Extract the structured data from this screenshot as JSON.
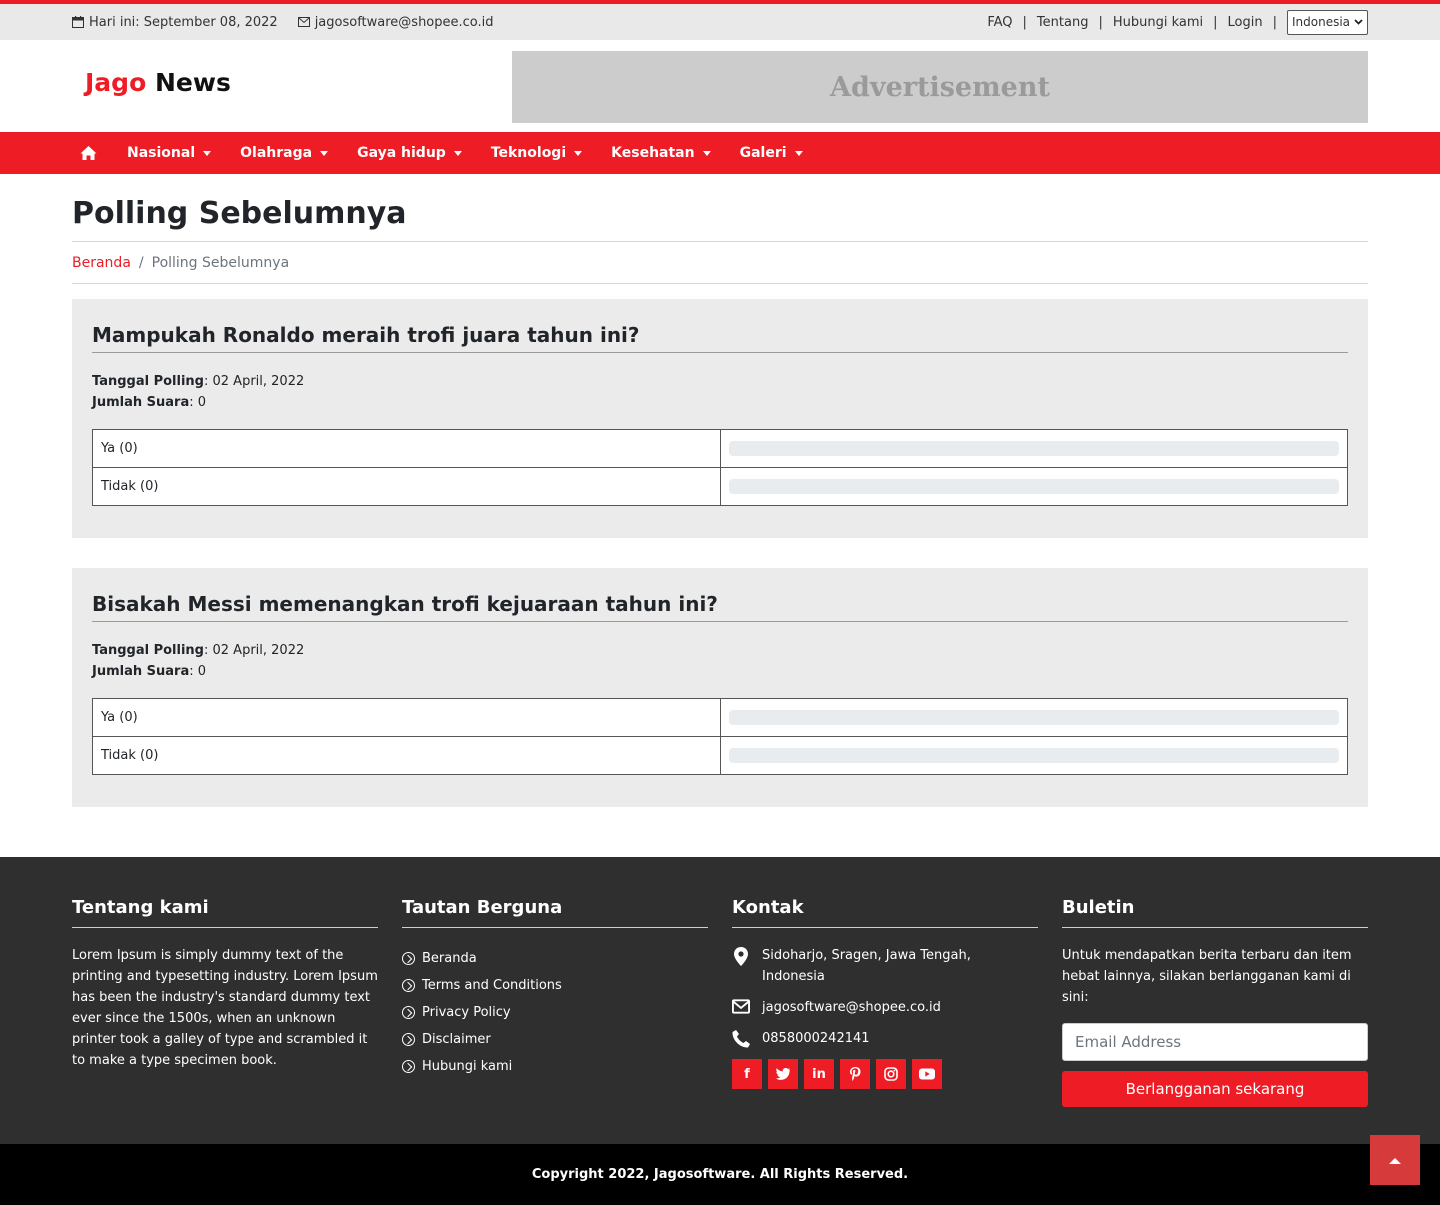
{
  "topbar": {
    "date": "Hari ini: September 08, 2022",
    "email": "jagosoftware@shopee.co.id",
    "links": [
      "FAQ",
      "Tentang",
      "Hubungi kami",
      "Login"
    ],
    "language": "Indonesia"
  },
  "header": {
    "logo_part1": "Jago",
    "logo_part2": "News",
    "ad_text": "Advertisement"
  },
  "nav": {
    "items": [
      "Nasional",
      "Olahraga",
      "Gaya hidup",
      "Teknologi",
      "Kesehatan",
      "Galeri"
    ]
  },
  "page": {
    "title": "Polling Sebelumnya",
    "breadcrumb_home": "Beranda",
    "breadcrumb_sep": "/",
    "breadcrumb_current": "Polling Sebelumnya"
  },
  "polls": [
    {
      "question": "Mampukah Ronaldo meraih trofi juara tahun ini?",
      "date_label": "Tanggal Polling",
      "date": ": 02 April, 2022",
      "votes_label": "Jumlah Suara",
      "votes": ": 0",
      "options": [
        {
          "label": "Ya (0)",
          "percent": 0
        },
        {
          "label": "Tidak (0)",
          "percent": 0
        }
      ]
    },
    {
      "question": "Bisakah Messi memenangkan trofi kejuaraan tahun ini?",
      "date_label": "Tanggal Polling",
      "date": ": 02 April, 2022",
      "votes_label": "Jumlah Suara",
      "votes": ": 0",
      "options": [
        {
          "label": "Ya (0)",
          "percent": 0
        },
        {
          "label": "Tidak (0)",
          "percent": 0
        }
      ]
    }
  ],
  "footer": {
    "about_title": "Tentang kami",
    "about_text": "Lorem Ipsum is simply dummy text of the printing and typesetting industry. Lorem Ipsum has been the industry's standard dummy text ever since the 1500s, when an unknown printer took a galley of type and scrambled it to make a type specimen book.",
    "links_title": "Tautan Berguna",
    "links": [
      "Beranda",
      "Terms and Conditions",
      "Privacy Policy",
      "Disclaimer",
      "Hubungi kami"
    ],
    "contact_title": "Kontak",
    "address": "Sidoharjo, Sragen, Jawa Tengah, Indonesia",
    "email": "jagosoftware@shopee.co.id",
    "phone": "0858000242141",
    "socials": [
      "facebook-icon",
      "twitter-icon",
      "linkedin-icon",
      "pinterest-icon",
      "instagram-icon",
      "youtube-icon"
    ],
    "newsletter_title": "Buletin",
    "newsletter_text": "Untuk mendapatkan berita terbaru dan item hebat lainnya, silakan berlangganan kami di sini:",
    "email_placeholder": "Email Address",
    "subscribe_label": "Berlangganan sekarang"
  },
  "copyright": "Copyright 2022, Jagosoftware. All Rights Reserved.",
  "colors": {
    "brand": "#ee1c25",
    "footer_bg": "#2f2f2f",
    "poll_bg": "#ebebeb"
  }
}
